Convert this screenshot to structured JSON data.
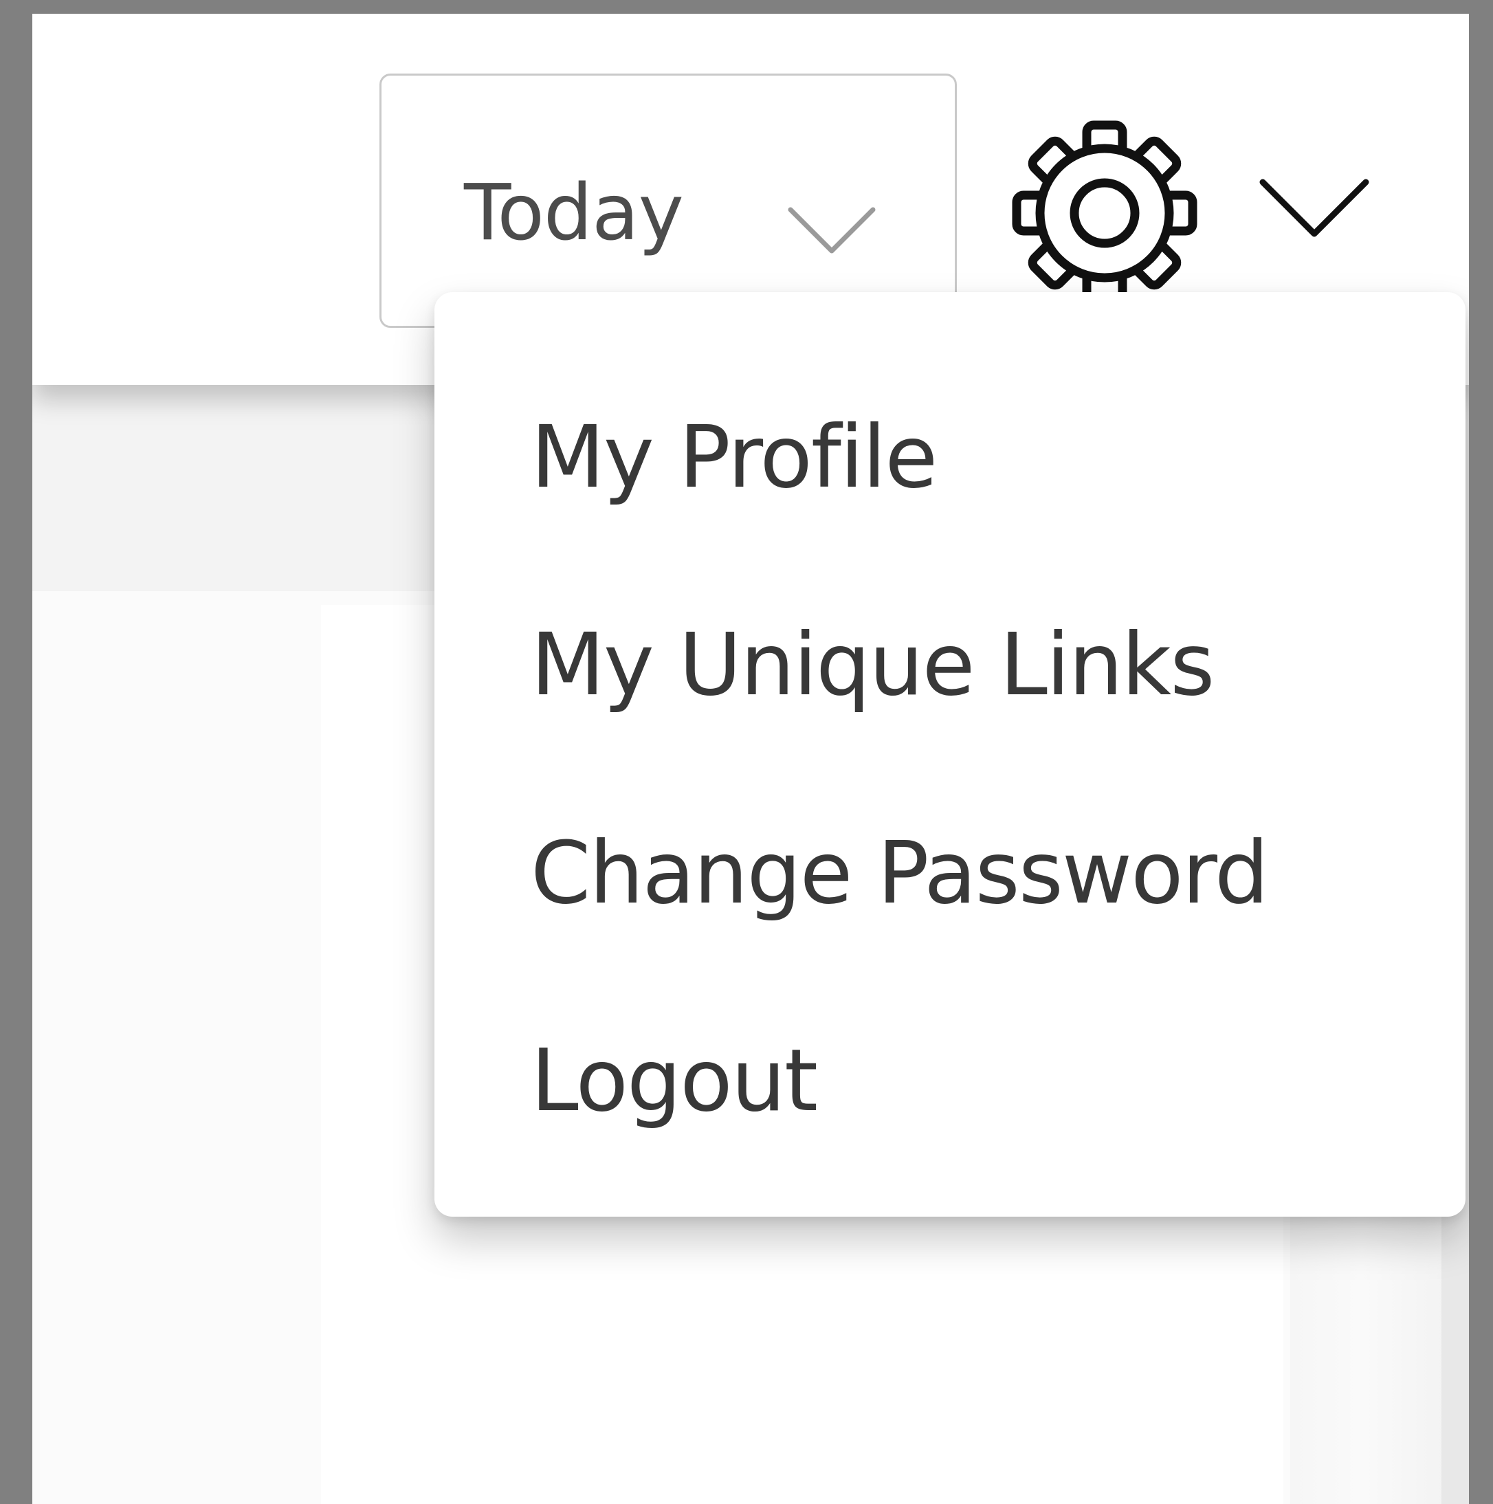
{
  "header": {
    "date_filter": {
      "selected": "Today",
      "chevron_icon": "chevron-down-icon"
    },
    "settings": {
      "gear_icon": "gear-icon",
      "chevron_icon": "chevron-down-icon"
    }
  },
  "profile_menu": {
    "items": [
      {
        "label": "My Profile"
      },
      {
        "label": "My Unique Links"
      },
      {
        "label": "Change Password"
      },
      {
        "label": "Logout"
      }
    ]
  },
  "colors": {
    "backdrop": "#808080",
    "text": "#383838",
    "border": "#c9c9c9",
    "icon_stroke": "#111111"
  }
}
